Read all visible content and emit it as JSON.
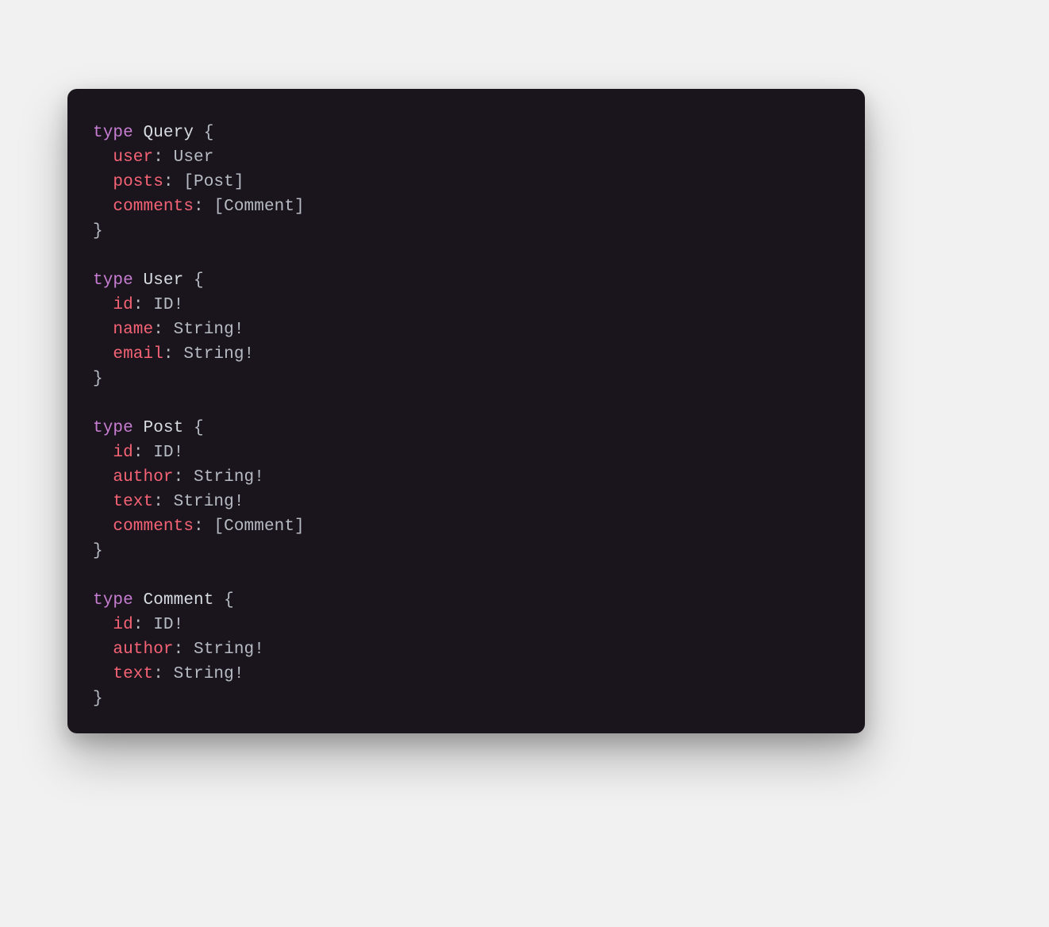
{
  "schema": {
    "keyword": "type",
    "types": [
      {
        "name": "Query",
        "fields": [
          {
            "name": "user",
            "type": "User"
          },
          {
            "name": "posts",
            "type": "[Post]"
          },
          {
            "name": "comments",
            "type": "[Comment]"
          }
        ]
      },
      {
        "name": "User",
        "fields": [
          {
            "name": "id",
            "type": "ID!"
          },
          {
            "name": "name",
            "type": "String!"
          },
          {
            "name": "email",
            "type": "String!"
          }
        ]
      },
      {
        "name": "Post",
        "fields": [
          {
            "name": "id",
            "type": "ID!"
          },
          {
            "name": "author",
            "type": "String!"
          },
          {
            "name": "text",
            "type": "String!"
          },
          {
            "name": "comments",
            "type": "[Comment]"
          }
        ]
      },
      {
        "name": "Comment",
        "fields": [
          {
            "name": "id",
            "type": "ID!"
          },
          {
            "name": "author",
            "type": "String!"
          },
          {
            "name": "text",
            "type": "String!"
          }
        ]
      }
    ]
  },
  "colors": {
    "background_page": "#f1f1f1",
    "background_card": "#1a151d",
    "text_default": "#b7bbc3",
    "keyword": "#c77dd1",
    "type_name": "#d7dbe2",
    "field_name": "#f56375"
  }
}
